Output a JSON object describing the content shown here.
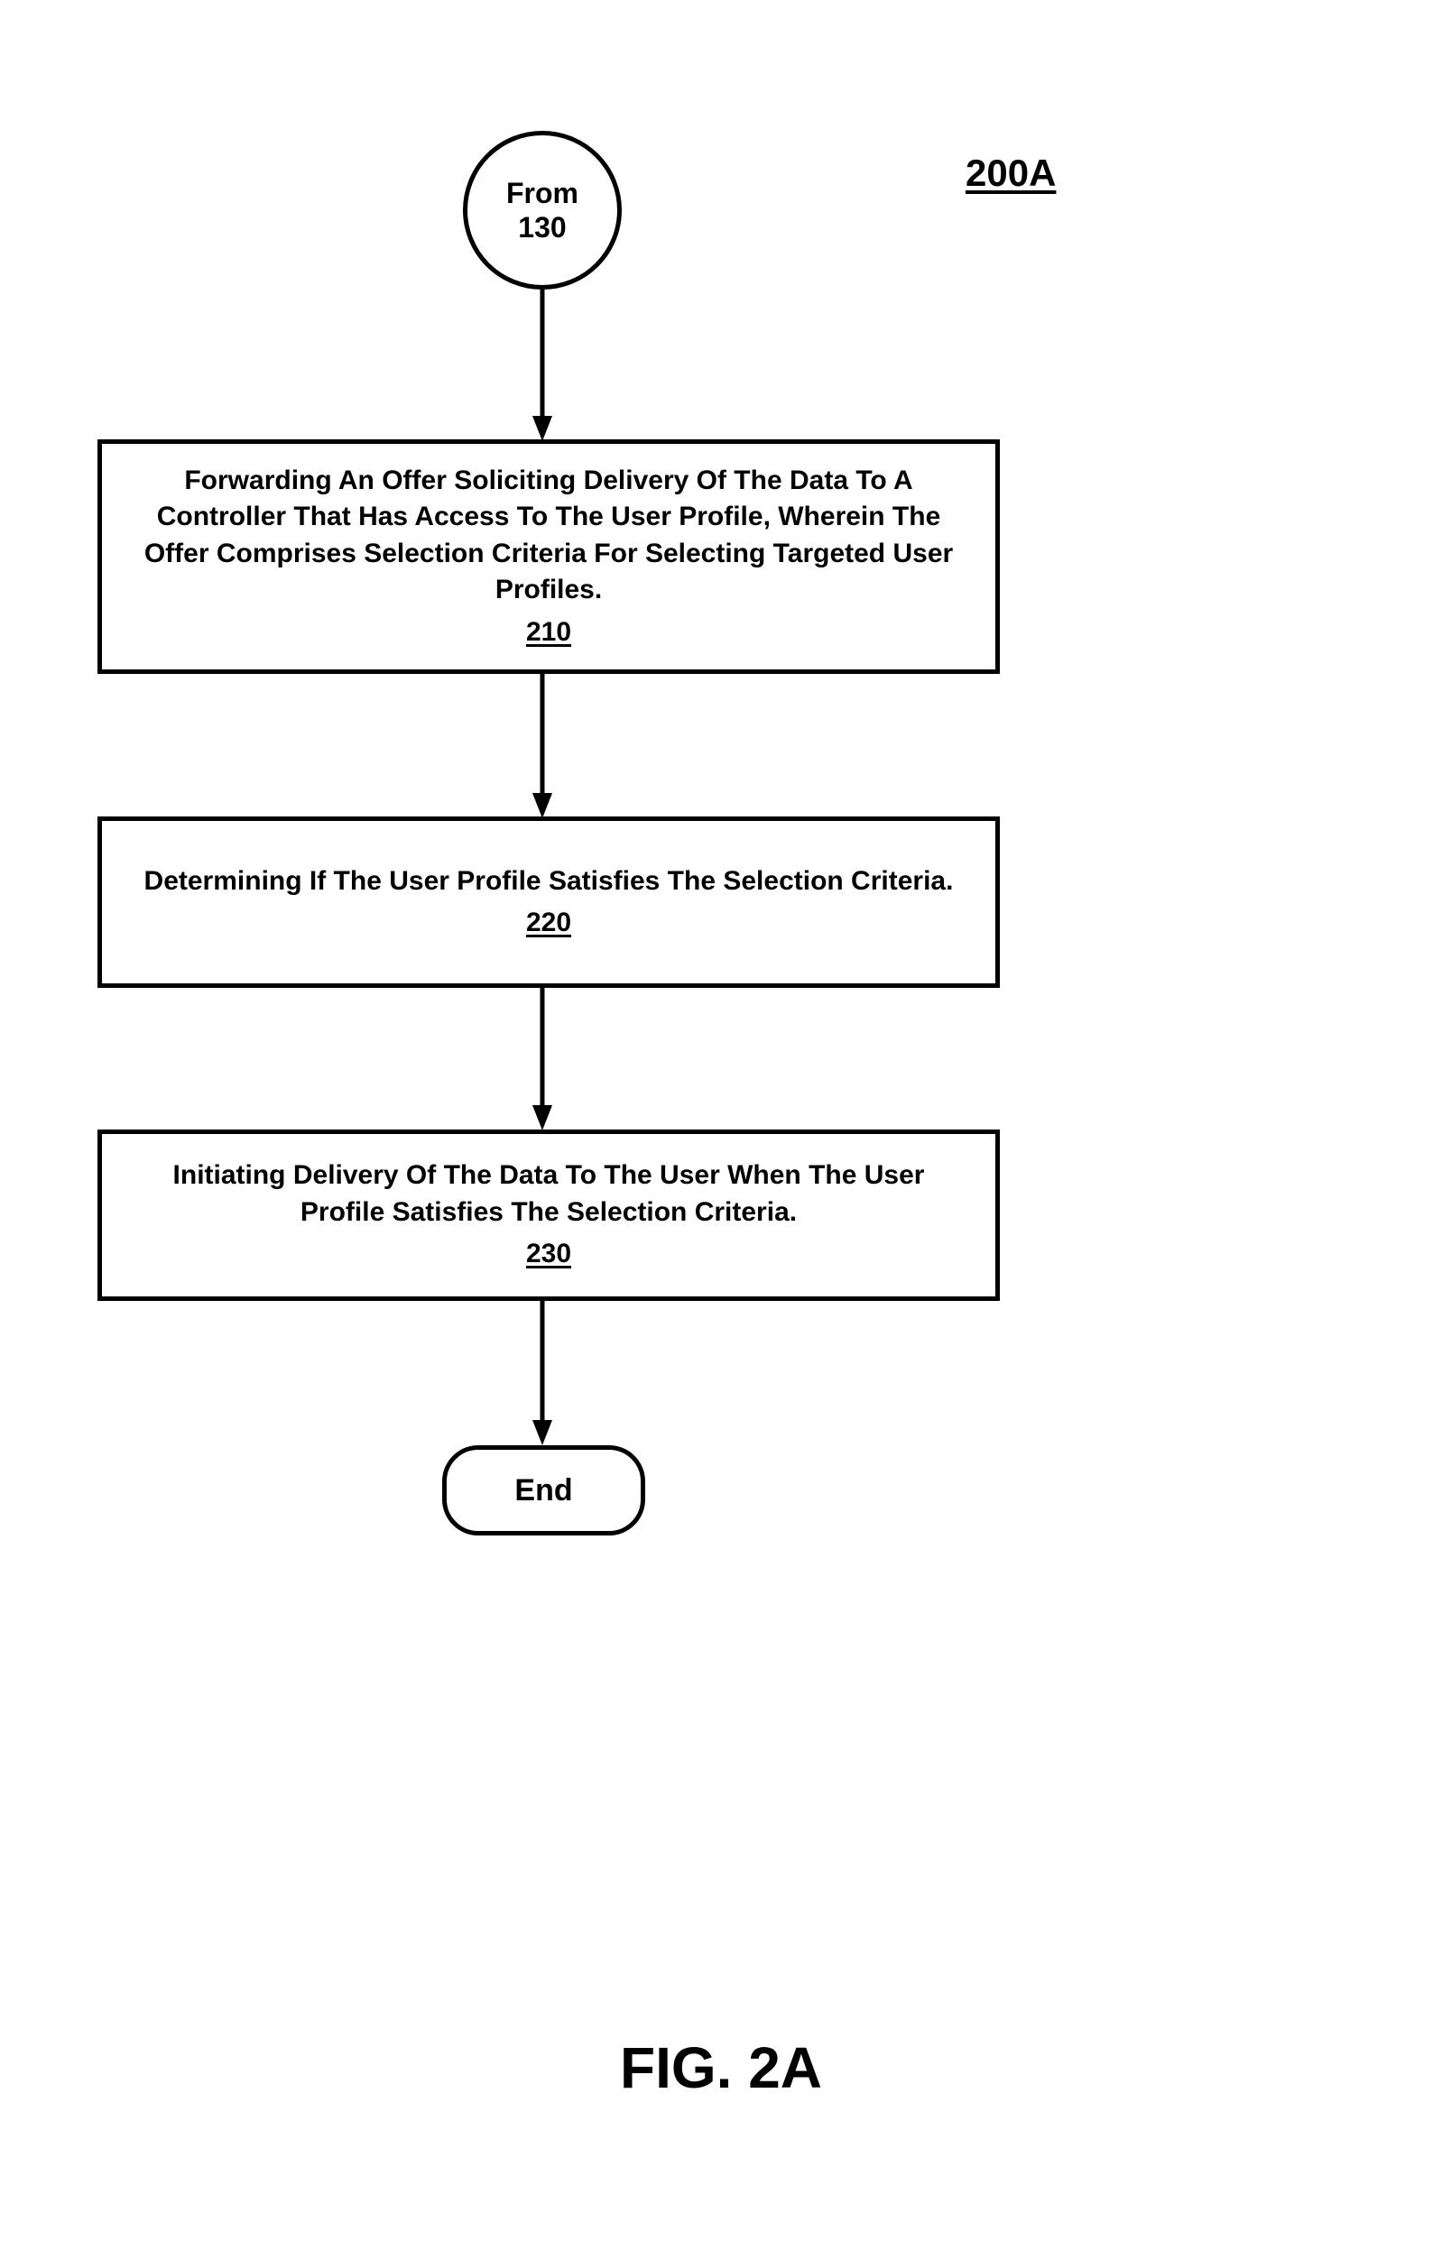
{
  "figure_label": "200A",
  "start": {
    "line1": "From",
    "line2": "130"
  },
  "steps": [
    {
      "text": "Forwarding An Offer Soliciting Delivery Of The Data To A Controller That Has Access To The User Profile, Wherein The Offer Comprises Selection Criteria For Selecting Targeted User Profiles.",
      "num": "210"
    },
    {
      "text": "Determining If The User Profile Satisfies The Selection Criteria.",
      "num": "220"
    },
    {
      "text": "Initiating Delivery Of The Data To The User When The User Profile Satisfies The Selection Criteria.",
      "num": "230"
    }
  ],
  "end": "End",
  "caption": "FIG. 2A"
}
